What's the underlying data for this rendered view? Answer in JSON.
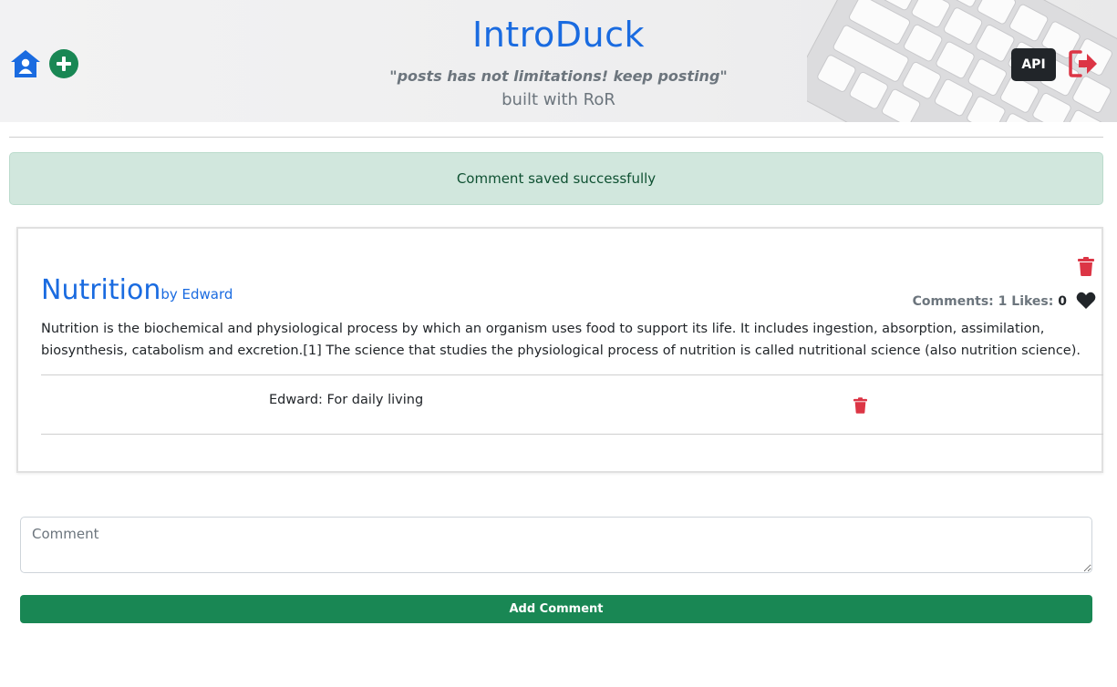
{
  "header": {
    "title": "IntroDuck",
    "tagline": "\"posts has not limitations! keep posting\"",
    "built_with": "built with RoR",
    "api_label": "API"
  },
  "alert": {
    "message": "Comment saved successfully"
  },
  "post": {
    "title": "Nutrition",
    "author": "by Edward",
    "comments_label": "Comments:",
    "comments_count": "1",
    "likes_label": "Likes:",
    "likes_count": "0",
    "body": "Nutrition is the biochemical and physiological process by which an organism uses food to support its life. It includes ingestion, absorption, assimilation, biosynthesis, catabolism and excretion.[1] The science that studies the physiological process of nutrition is called nutritional science (also nutrition science).",
    "comments": [
      {
        "text": "Edward: For daily living"
      }
    ]
  },
  "form": {
    "comment_placeholder": "Comment",
    "submit_label": "Add Comment"
  },
  "colors": {
    "brand_blue": "#1a6be0",
    "success_green": "#198754",
    "danger_red": "#dc3545",
    "alert_bg": "#d1e7dd"
  },
  "icons": [
    "home-user-icon",
    "plus-circle-icon",
    "logout-icon",
    "trash-icon",
    "heart-icon"
  ]
}
